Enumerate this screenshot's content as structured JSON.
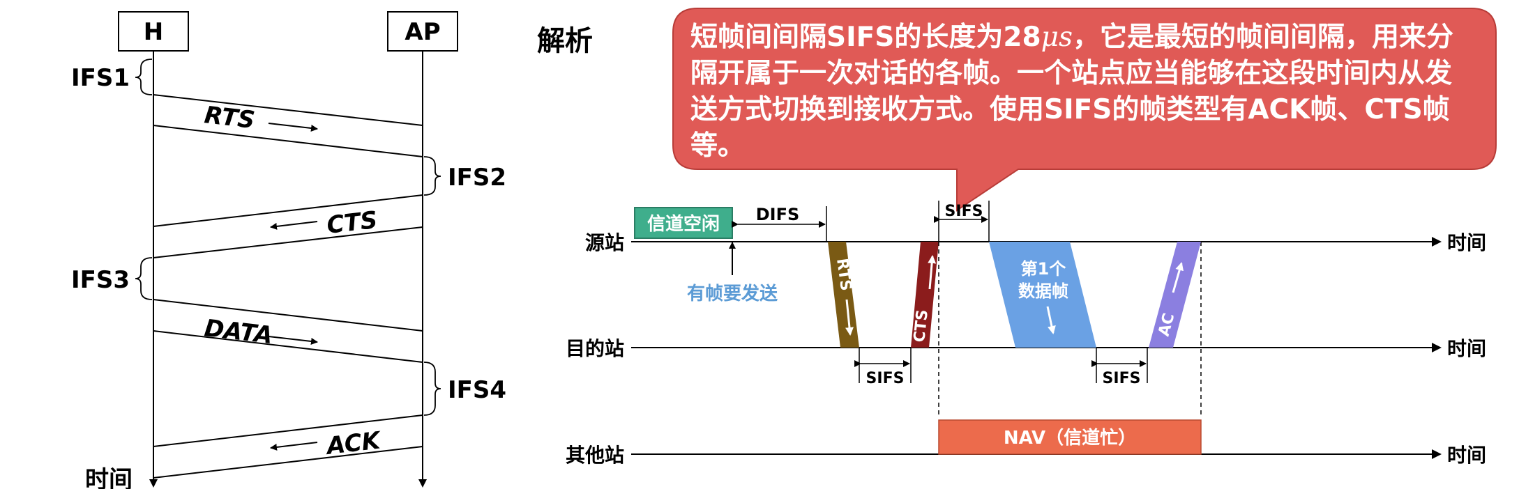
{
  "left_diagram": {
    "stations": {
      "h": "H",
      "ap": "AP"
    },
    "ifs": [
      "IFS1",
      "IFS2",
      "IFS3",
      "IFS4"
    ],
    "frames": [
      "RTS",
      "CTS",
      "DATA",
      "ACK"
    ],
    "time_label": "时间"
  },
  "analysis_title": "解析",
  "callout": {
    "part1": "短帧间间隔SIFS的长度为28",
    "unit": "μs",
    "part2": "，它是最短的帧间间隔，用来分隔开属于一次对话的各帧。一个站点应当能够在这段时间内从发送方式切换到接收方式。使用SIFS的帧类型有ACK帧、CTS帧等。",
    "color": "#e05a56"
  },
  "right_diagram": {
    "rows": {
      "source": "源站",
      "destination": "目的站",
      "others": "其他站"
    },
    "time_label": "时间",
    "channel_idle": "信道空闲",
    "difs": "DIFS",
    "sifs": "SIFS",
    "has_frame": "有帧要发送",
    "rts": "RTS",
    "cts": "CTS",
    "data_line1": "第1个",
    "data_line2": "数据帧",
    "ack": "AC",
    "nav": "NAV（信道忙）",
    "colors": {
      "idle": "#3fae8c",
      "rts": "#7a5a14",
      "cts": "#8b1c1c",
      "data": "#6aa1e4",
      "ack": "#8b7fe0",
      "nav": "#ec6b4c",
      "has_frame_text": "#5b9bd5"
    }
  }
}
